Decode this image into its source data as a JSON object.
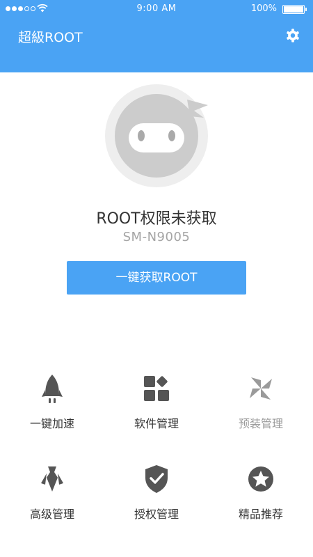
{
  "status_bar": {
    "time": "9:00 AM",
    "battery": "100%"
  },
  "header": {
    "title": "超級ROOT"
  },
  "main": {
    "status_title": "ROOT权限未获取",
    "device_model": "SM-N9005",
    "root_button_label": "一键获取ROOT"
  },
  "features": [
    {
      "label": "一键加速",
      "icon": "rocket-icon"
    },
    {
      "label": "软件管理",
      "icon": "apps-grid-icon"
    },
    {
      "label": "预装管理",
      "icon": "pinwheel-icon"
    },
    {
      "label": "高级管理",
      "icon": "tie-shirt-icon"
    },
    {
      "label": "授权管理",
      "icon": "shield-check-icon"
    },
    {
      "label": "精品推荐",
      "icon": "star-circle-icon"
    }
  ],
  "colors": {
    "primary": "#4aa3f4",
    "icon_dark": "#555555",
    "icon_muted": "#9a9a9a"
  }
}
